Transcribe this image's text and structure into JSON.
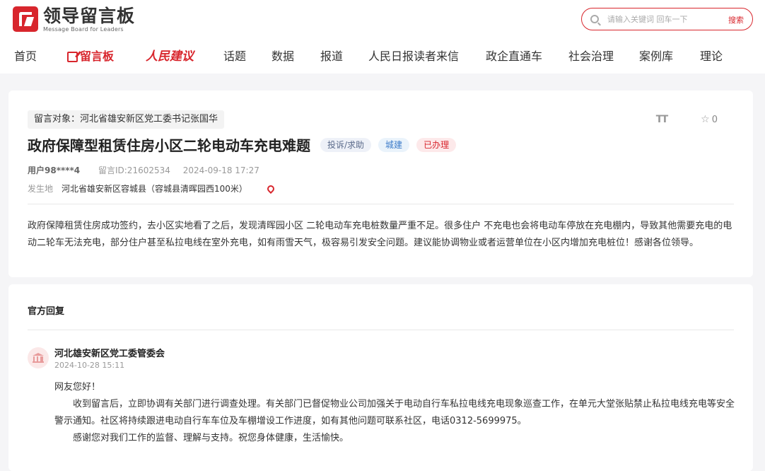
{
  "header": {
    "logo_cn": "领导留言板",
    "logo_en": "Message Board for Leaders",
    "search_placeholder": "请输入关键词 回车一下",
    "search_button": "搜索",
    "nav": [
      "首页",
      "留言板",
      "人民建议",
      "话题",
      "数据",
      "报道",
      "人民日报读者来信",
      "政企直通车",
      "社会治理",
      "案例库",
      "理论"
    ]
  },
  "message": {
    "target": "留言对象：河北省雄安新区党工委书记张国华",
    "font_tool": "TT",
    "favorite_count": "0",
    "title": "政府保障型租赁住房小区二轮电动车充电难题",
    "type": "投诉/求助",
    "field": "城建",
    "status": "已办理",
    "user": "用户98****4",
    "message_id": "留言ID:21602534",
    "datetime": "2024-09-18 17:27",
    "location_label": "发生地",
    "location": "河北省雄安新区容城县（容城县清晖园西100米）",
    "content": "政府保障租赁住房成功签约，去小区实地看了之后，发现清晖园小区 二轮电动车充电桩数量严重不足。很多住户 不充电也会将电动车停放在充电棚内，导致其他需要充电的电动二轮车无法充电，部分住户甚至私拉电线在室外充电，如有雨雪天气，极容易引发安全问题。建议能协调物业或者运营单位在小区内增加充电桩位！感谢各位领导。"
  },
  "reply": {
    "heading": "官方回复",
    "org": "河北雄安新区党工委管委会",
    "date": "2024-10-28 15:11",
    "greeting": "网友您好！",
    "para1": "收到留言后，立即协调有关部门进行调查处理。有关部门已督促物业公司加强关于电动自行车私拉电线充电现象巡查工作，在单元大堂张贴禁止私拉电线充电等安全警示通知。社区将持续跟进电动自行车车位及车棚增设工作进度，如有其他问题可联系社区，电话0312-5699975。",
    "para2": "感谢您对我们工作的监督、理解与支持。祝您身体健康，生活愉快。"
  },
  "colors": {
    "brand": "#d8262d",
    "field_badge": "#3d7cc9",
    "type_badge": "#5a6a8a"
  },
  "icons": [
    "logo-icon",
    "search-icon",
    "edit-icon",
    "font-size-icon",
    "star-icon",
    "location-pin-icon",
    "government-building-icon"
  ]
}
